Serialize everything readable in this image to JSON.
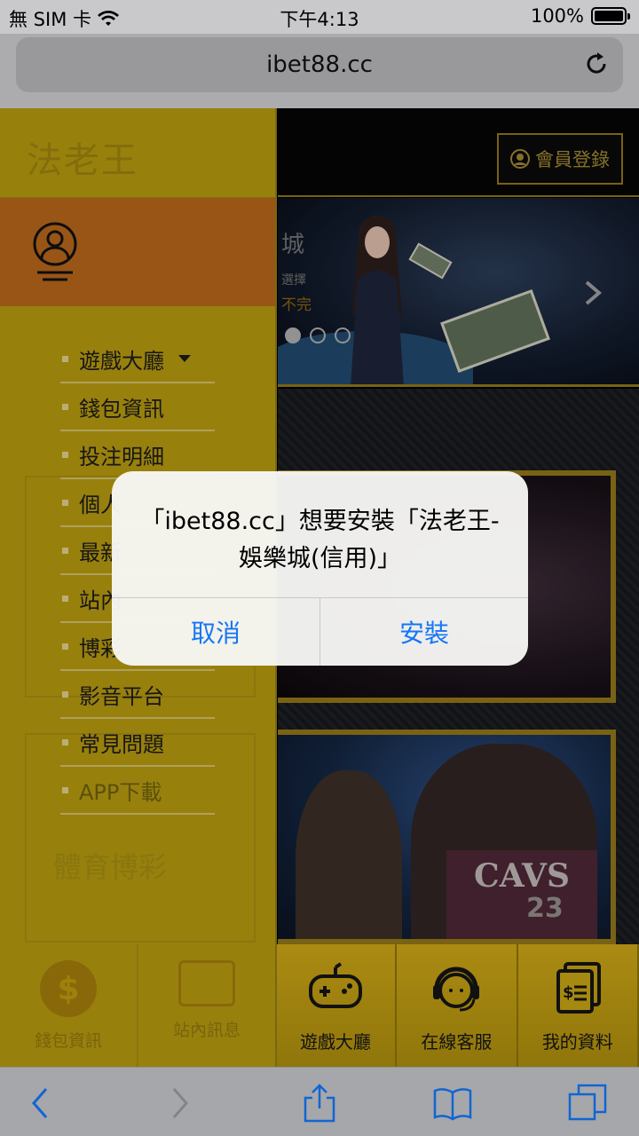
{
  "status_bar": {
    "carrier": "無 SIM 卡",
    "time": "下午4:13",
    "battery": "100%"
  },
  "browser": {
    "url": "ibet88.cc"
  },
  "header": {
    "login_label": "會員登錄"
  },
  "banner": {
    "text_top": "城",
    "text_mid": "選擇",
    "text_bottom": "不完",
    "slides": 3,
    "active_slide": 1
  },
  "side_menu": {
    "logo": "法老王",
    "items": [
      {
        "label": "遊戲大廳"
      },
      {
        "label": "錢包資訊"
      },
      {
        "label": "投注明細"
      },
      {
        "label": "個人"
      },
      {
        "label": "最新"
      },
      {
        "label": "站內"
      },
      {
        "label": "博彩"
      },
      {
        "label": "影音平台"
      },
      {
        "label": "常見問題"
      },
      {
        "label": "APP下載"
      }
    ],
    "ghost_text": "體育博彩",
    "bottom": [
      {
        "label": "錢包資訊"
      },
      {
        "label": "站內訊息"
      }
    ]
  },
  "tab_bar": [
    {
      "label": "遊戲大廳",
      "icon": "gamepad-icon"
    },
    {
      "label": "在線客服",
      "icon": "headset-icon"
    },
    {
      "label": "我的資料",
      "icon": "documents-icon"
    }
  ],
  "sports_card": {
    "jersey_text": "CAVS",
    "jersey_number": "23"
  },
  "alert": {
    "message": "「ibet88.cc」想要安裝「法老王-娛樂城(信用)」",
    "cancel_label": "取消",
    "install_label": "安裝"
  },
  "colors": {
    "menu_gold": "#b19510",
    "profile_band": "#b2641a",
    "alert_button": "#1476f6"
  }
}
